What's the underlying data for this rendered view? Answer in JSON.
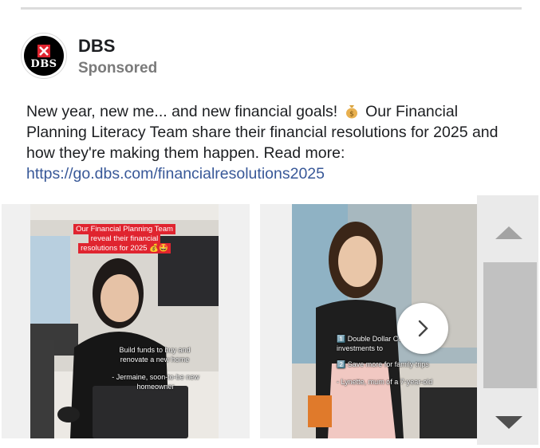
{
  "post": {
    "page_name": "DBS",
    "sponsored_label": "Sponsored",
    "text_part1": "New year, new me... and new financial goals!",
    "text_emoji_icon": "money-bag-icon",
    "text_part2": "Our Financial Planning Literacy Team share their financial resolutions for 2025 and how they're making them happen. Read more:",
    "link": "https://go.dbs.com/financialresolutions2025",
    "avatar": {
      "logo_text": "DBS",
      "logo_icon": "dbs-star-icon",
      "brand_color": "#e0242f"
    }
  },
  "carousel": {
    "cards": [
      {
        "title_caption": "Our Financial Planning Team reveal their financial resolutions for 2025 💰🤩",
        "caption_line1": "Build funds to buy and renovate a new home",
        "caption_line2": "- Jermaine, soon-to-be new homeowner"
      },
      {
        "caption_line1": "1️⃣ Double Dollar Cost (DCA) investments to",
        "caption_line2": "2️⃣ Save more for family trips",
        "caption_line3": "- Lynette, mum of a 7-year-old"
      }
    ],
    "next_icon": "chevron-right-icon"
  },
  "scrollbar": {
    "up_icon": "triangle-up-icon",
    "down_icon": "triangle-down-icon"
  }
}
